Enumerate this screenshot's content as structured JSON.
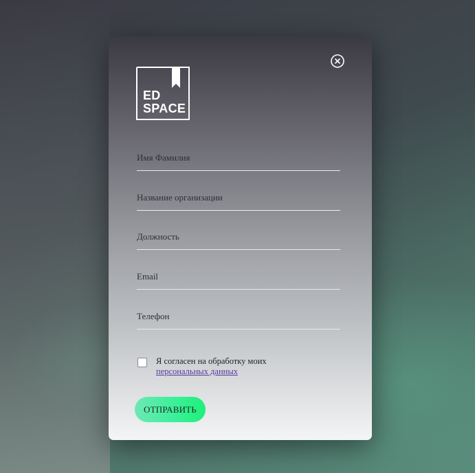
{
  "logo": {
    "line1": "ED",
    "line2": "SPACE"
  },
  "close": {
    "icon": "close-icon"
  },
  "form": {
    "fields": [
      {
        "placeholder": "Имя Фамилия",
        "value": ""
      },
      {
        "placeholder": "Название организации",
        "value": ""
      },
      {
        "placeholder": "Должность",
        "value": ""
      },
      {
        "placeholder": "Email",
        "value": ""
      },
      {
        "placeholder": "Телефон",
        "value": ""
      }
    ],
    "consent": {
      "text": "Я согласен на обработку моих",
      "link": "персональных данных",
      "checked": false
    },
    "submit_label": "ОТПРАВИТЬ"
  },
  "colors": {
    "accent": "#3cf09a",
    "link": "#5b3aa0"
  }
}
